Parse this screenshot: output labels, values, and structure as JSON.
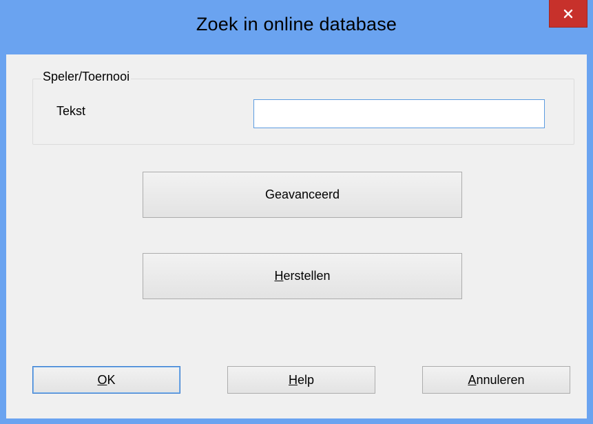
{
  "window": {
    "title": "Zoek in online database",
    "close_icon": "close-icon"
  },
  "groupbox": {
    "label": "Speler/Toernooi",
    "field_label": "Tekst",
    "field_value": ""
  },
  "buttons": {
    "advanced": "Geavanceerd",
    "reset_mnemonic": "H",
    "reset_rest": "erstellen",
    "ok_mnemonic": "O",
    "ok_rest": "K",
    "help_mnemonic": "H",
    "help_rest": "elp",
    "cancel_mnemonic": "A",
    "cancel_rest": "nnuleren"
  },
  "colors": {
    "titlebar": "#6aa3f0",
    "close_button": "#c7312b",
    "client": "#f0f0f0",
    "focus_border": "#3c7fd1"
  }
}
